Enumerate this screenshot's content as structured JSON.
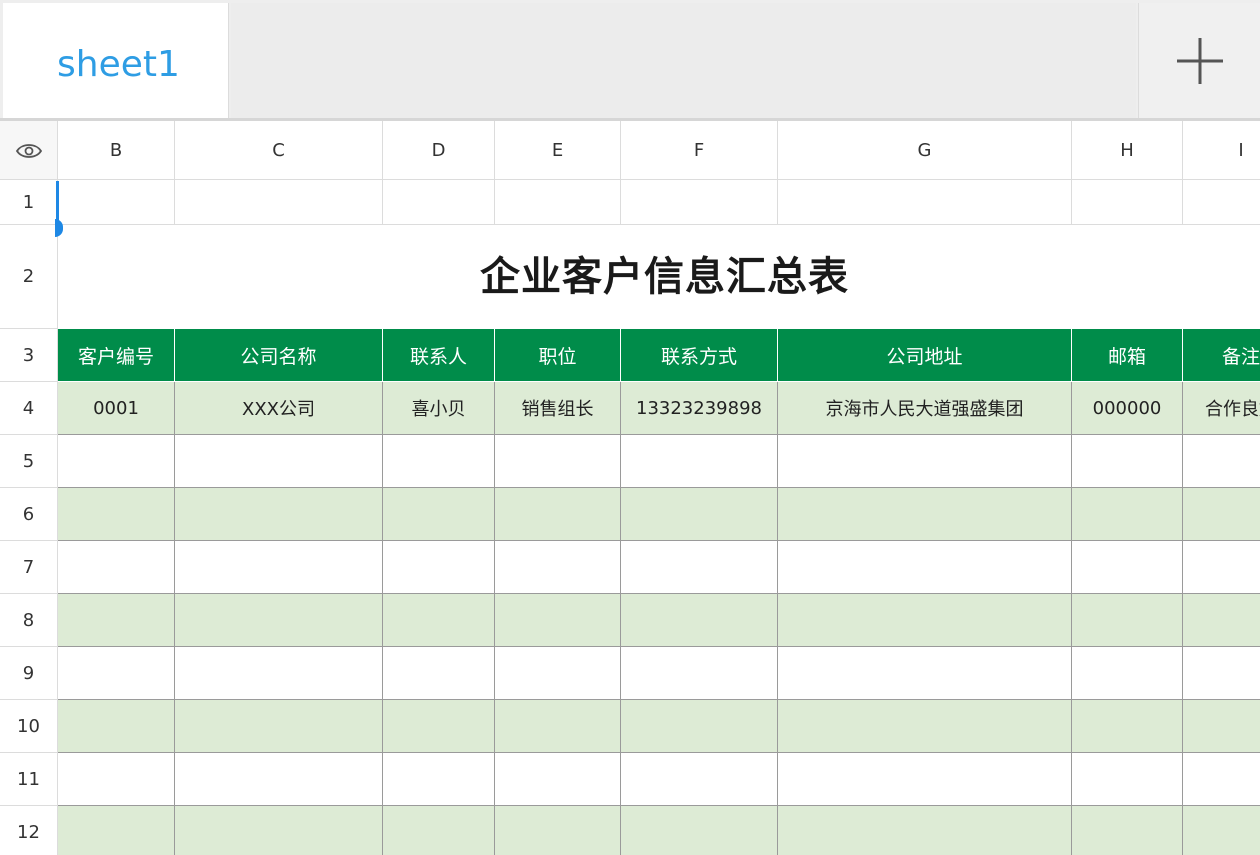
{
  "tabs": {
    "active_label": "sheet1",
    "add_icon": "plus-icon"
  },
  "grid": {
    "corner_icon": "eye-icon",
    "columns": [
      "B",
      "C",
      "D",
      "E",
      "F",
      "G",
      "H",
      "I"
    ],
    "rows": [
      "1",
      "2",
      "3",
      "4",
      "5",
      "6",
      "7",
      "8",
      "9",
      "10",
      "11",
      "12"
    ],
    "title": "企业客户信息汇总表",
    "headers": [
      "客户编号",
      "公司名称",
      "联系人",
      "职位",
      "联系方式",
      "公司地址",
      "邮箱",
      "备注"
    ],
    "data_rows": [
      [
        "0001",
        "XXX公司",
        "喜小贝",
        "销售组长",
        "13323239898",
        "京海市人民大道强盛集团",
        "000000",
        "合作良好"
      ]
    ]
  },
  "colors": {
    "header_bg": "#008c4a",
    "band_green": "#ddebd5",
    "tab_accent": "#2e9de4",
    "selection": "#1e88e5"
  }
}
